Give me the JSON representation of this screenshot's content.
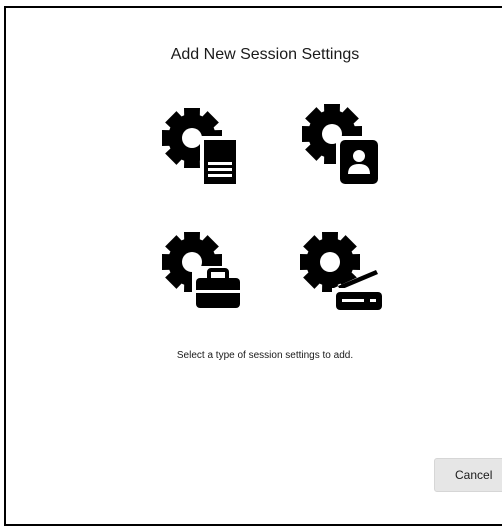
{
  "dialog": {
    "title": "Add New Session Settings",
    "hint": "Select a type of session settings to add.",
    "cancel_label": "Cancel"
  },
  "options": [
    {
      "icon": "gear-document-icon"
    },
    {
      "icon": "gear-contact-card-icon"
    },
    {
      "icon": "gear-briefcase-icon"
    },
    {
      "icon": "gear-scanner-icon"
    }
  ],
  "colors": {
    "icon": "#000000",
    "button_bg": "#e6e6e6"
  }
}
